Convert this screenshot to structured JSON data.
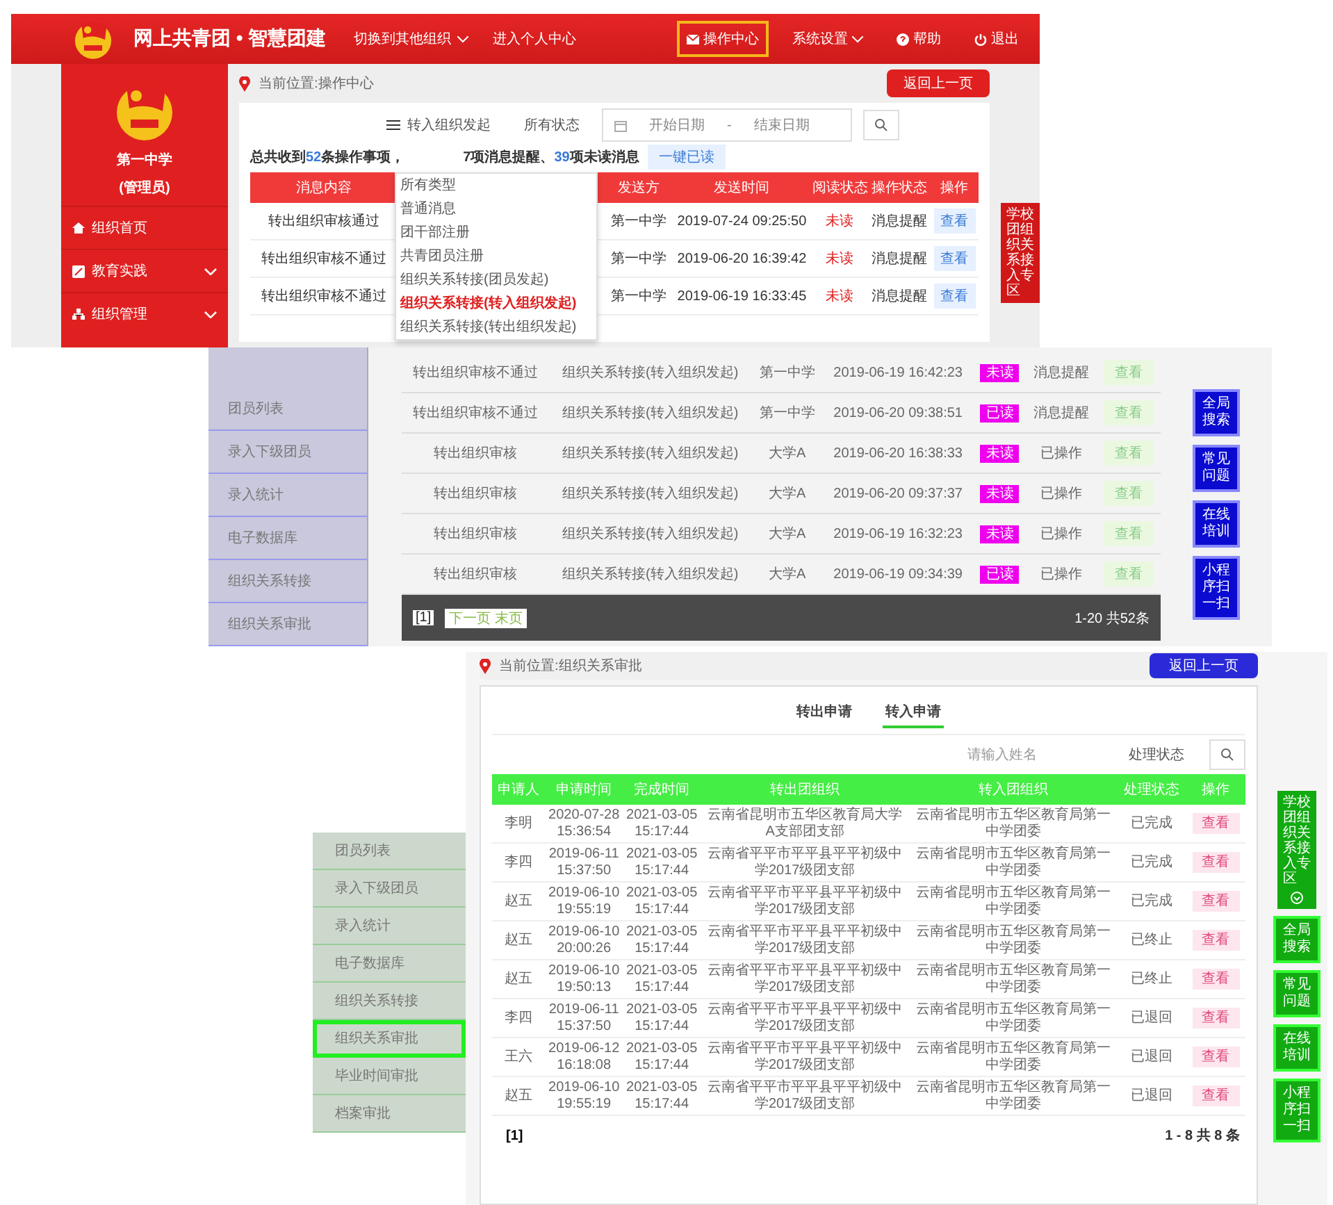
{
  "operation_center": {
    "brand": "网上共青团 • 智慧团建",
    "nav_links": [
      {
        "label": "切换到其他组织",
        "caret": true
      },
      {
        "label": "进入个人中心",
        "caret": false
      }
    ],
    "right_links": [
      {
        "label": "操作中心",
        "selected": true
      },
      {
        "label": "系统设置",
        "selected": false
      },
      {
        "label": "帮助",
        "selected": false
      },
      {
        "label": "退出",
        "selected": false
      }
    ],
    "sidebar": {
      "org_name": "第一中学",
      "role": "(管理员)",
      "items": [
        {
          "label": "组织首页",
          "expandable": false
        },
        {
          "label": "教育实践",
          "expandable": true
        },
        {
          "label": "组织管理",
          "expandable": true
        }
      ]
    },
    "breadcrumb": "当前位置:操作中心",
    "back_button": "返回上一页",
    "filters": {
      "type": "转入组织发起",
      "status": "所有状态",
      "start_date": "开始日期",
      "range_separator": "-",
      "end_date": "结束日期"
    },
    "summary": "总共收到**52**条操作事项，",
    "summary_tail": "7项消息提醒、**39**项未读消息",
    "mark_read_button": "一键已读",
    "type_options": [
      {
        "label": "所有类型",
        "selected": false
      },
      {
        "label": "普通消息",
        "selected": false
      },
      {
        "label": "团干部注册",
        "selected": false
      },
      {
        "label": "共青团员注册",
        "selected": false
      },
      {
        "label": "组织关系转接(团员发起)",
        "selected": false
      },
      {
        "label": "组织关系转接(转入组织发起)",
        "selected": true
      },
      {
        "label": "组织关系转接(转出组织发起)",
        "selected": false
      }
    ],
    "columns": [
      "消息内容",
      "发送方",
      "发送时间",
      "阅读状态",
      "操作状态",
      "操作"
    ],
    "rows": [
      {
        "content": "转出组织审核通过",
        "sender": "第一中学",
        "time": "2019-07-24 09:25:50",
        "read_status": "未读",
        "op_status": "消息提醒",
        "action": "查看"
      },
      {
        "content": "转出组织审核不通过",
        "sender": "第一中学",
        "time": "2019-06-20 16:39:42",
        "read_status": "未读",
        "op_status": "消息提醒",
        "action": "查看"
      },
      {
        "content": "转出组织审核不通过",
        "sender": "第一中学",
        "time": "2019-06-19 16:33:45",
        "read_status": "未读",
        "op_status": "消息提醒",
        "action": "查看"
      }
    ],
    "side_tag": "学校团组织关系接入专区"
  },
  "message_list": {
    "sidebar_items": [
      "团员列表",
      "录入下级团员",
      "录入统计",
      "电子数据库",
      "组织关系转接",
      "组织关系审批"
    ],
    "rows": [
      {
        "content": "转出组织审核不通过",
        "type": "组织关系转接(转入组织发起)",
        "sender": "第一中学",
        "time": "2019-06-19 16:42:23",
        "read_status": "未读",
        "op_status": "消息提醒",
        "action": "查看"
      },
      {
        "content": "转出组织审核不通过",
        "type": "组织关系转接(转入组织发起)",
        "sender": "第一中学",
        "time": "2019-06-20 09:38:51",
        "read_status": "已读",
        "op_status": "消息提醒",
        "action": "查看"
      },
      {
        "content": "转出组织审核",
        "type": "组织关系转接(转入组织发起)",
        "sender": "大学A",
        "time": "2019-06-20 16:38:33",
        "read_status": "未读",
        "op_status": "已操作",
        "action": "查看"
      },
      {
        "content": "转出组织审核",
        "type": "组织关系转接(转入组织发起)",
        "sender": "大学A",
        "time": "2019-06-20 09:37:37",
        "read_status": "未读",
        "op_status": "已操作",
        "action": "查看"
      },
      {
        "content": "转出组织审核",
        "type": "组织关系转接(转入组织发起)",
        "sender": "大学A",
        "time": "2019-06-19 16:32:23",
        "read_status": "未读",
        "op_status": "已操作",
        "action": "查看"
      },
      {
        "content": "转出组织审核",
        "type": "组织关系转接(转入组织发起)",
        "sender": "大学A",
        "time": "2019-06-19 09:34:39",
        "read_status": "已读",
        "op_status": "已操作",
        "action": "查看"
      }
    ],
    "pages": "[1]",
    "next_links": "下一页 末页",
    "total": "1-20 共52条",
    "float_buttons": [
      "全局搜索",
      "常见问题",
      "在线培训",
      "小程序扫一扫"
    ]
  },
  "transfer_approval": {
    "breadcrumb": "当前位置:组织关系审批",
    "back_button": "返回上一页",
    "sidebar_items": [
      {
        "label": "团员列表",
        "selected": false
      },
      {
        "label": "录入下级团员",
        "selected": false
      },
      {
        "label": "录入统计",
        "selected": false
      },
      {
        "label": "电子数据库",
        "selected": false
      },
      {
        "label": "组织关系转接",
        "selected": false
      },
      {
        "label": "组织关系审批",
        "selected": true
      },
      {
        "label": "毕业时间审批",
        "selected": false
      },
      {
        "label": "档案审批",
        "selected": false
      }
    ],
    "tabs": [
      {
        "label": "转出申请",
        "selected": false
      },
      {
        "label": "转入申请",
        "selected": true
      }
    ],
    "name_placeholder": "请输入姓名",
    "status_select": "处理状态",
    "columns": [
      "申请人",
      "申请时间",
      "完成时间",
      "转出团组织",
      "转入团组织",
      "处理状态",
      "操作"
    ],
    "rows": [
      {
        "applicant": "李明",
        "applied": "2020-07-28 15:36:54",
        "done": "2021-03-05 15:17:44",
        "from_org": "云南省昆明市五华区教育局大学A支部团支部",
        "to_org": "云南省昆明市五华区教育局第一中学团委",
        "status": "已完成",
        "action": "查看"
      },
      {
        "applicant": "李四",
        "applied": "2019-06-11 15:37:50",
        "done": "2021-03-05 15:17:44",
        "from_org": "云南省平平市平平县平平初级中学2017级团支部",
        "to_org": "云南省昆明市五华区教育局第一中学团委",
        "status": "已完成",
        "action": "查看"
      },
      {
        "applicant": "赵五",
        "applied": "2019-06-10 19:55:19",
        "done": "2021-03-05 15:17:44",
        "from_org": "云南省平平市平平县平平初级中学2017级团支部",
        "to_org": "云南省昆明市五华区教育局第一中学团委",
        "status": "已完成",
        "action": "查看"
      },
      {
        "applicant": "赵五",
        "applied": "2019-06-10 20:00:26",
        "done": "2021-03-05 15:17:44",
        "from_org": "云南省平平市平平县平平初级中学2017级团支部",
        "to_org": "云南省昆明市五华区教育局第一中学团委",
        "status": "已终止",
        "action": "查看"
      },
      {
        "applicant": "赵五",
        "applied": "2019-06-10 19:50:13",
        "done": "2021-03-05 15:17:44",
        "from_org": "云南省平平市平平县平平初级中学2017级团支部",
        "to_org": "云南省昆明市五华区教育局第一中学团委",
        "status": "已终止",
        "action": "查看"
      },
      {
        "applicant": "李四",
        "applied": "2019-06-11 15:37:50",
        "done": "2021-03-05 15:17:44",
        "from_org": "云南省平平市平平县平平初级中学2017级团支部",
        "to_org": "云南省昆明市五华区教育局第一中学团委",
        "status": "已退回",
        "action": "查看"
      },
      {
        "applicant": "王六",
        "applied": "2019-06-12 16:18:08",
        "done": "2021-03-05 15:17:44",
        "from_org": "云南省平平市平平县平平初级中学2017级团支部",
        "to_org": "云南省昆明市五华区教育局第一中学团委",
        "status": "已退回",
        "action": "查看"
      },
      {
        "applicant": "赵五",
        "applied": "2019-06-10 19:55:19",
        "done": "2021-03-05 15:17:44",
        "from_org": "云南省平平市平平县平平初级中学2017级团支部",
        "to_org": "云南省昆明市五华区教育局第一中学团委",
        "status": "已退回",
        "action": "查看"
      }
    ],
    "pages": "[1]",
    "total": "1 - 8  共 8 条",
    "side_tag": "学校团组织关系接入专区",
    "float_buttons": [
      "全局搜索",
      "常见问题",
      "在线培训",
      "小程序扫一扫"
    ]
  }
}
